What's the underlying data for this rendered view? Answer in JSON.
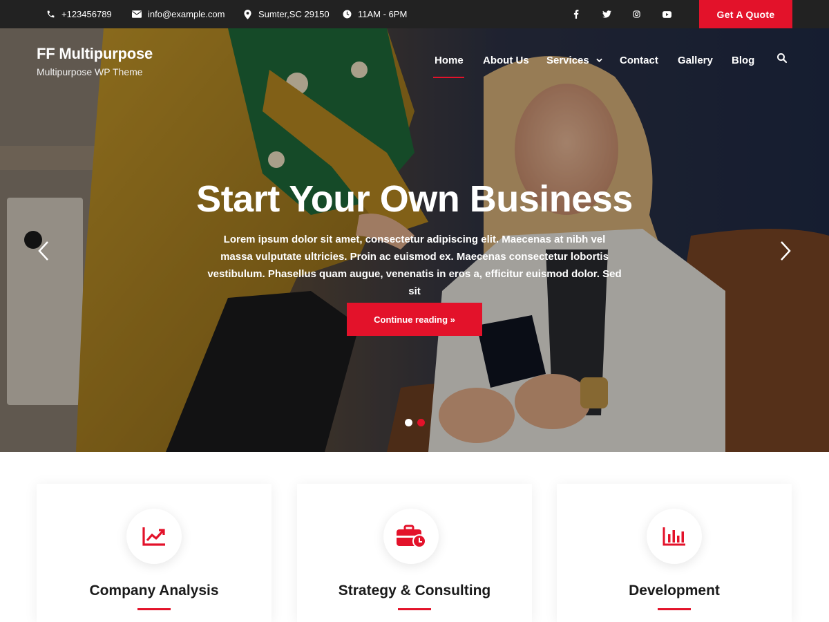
{
  "colors": {
    "accent": "#e3122a",
    "topbar_bg": "#222222",
    "text_dark": "#1a1a1a"
  },
  "topbar": {
    "phone": "+123456789",
    "email": "info@example.com",
    "address": "Sumter,SC 29150",
    "hours": "11AM - 6PM",
    "social_icons": [
      "facebook-icon",
      "twitter-icon",
      "instagram-icon",
      "youtube-icon"
    ],
    "quote_label": "Get A Quote"
  },
  "header": {
    "site_title": "FF Multipurpose",
    "tagline": "Multipurpose WP Theme",
    "nav": [
      {
        "label": "Home",
        "active": true
      },
      {
        "label": "About Us"
      },
      {
        "label": "Services",
        "has_dropdown": true
      },
      {
        "label": "Contact"
      },
      {
        "label": "Gallery"
      },
      {
        "label": "Blog"
      }
    ]
  },
  "hero": {
    "title": "Start Your Own Business",
    "text": "Lorem ipsum dolor sit amet, consectetur adipiscing elit. Maecenas at nibh vel massa vulputate ultricies. Proin ac euismod ex. Maecenas consectetur lobortis vestibulum. Phasellus quam augue, venenatis in eros a, efficitur euismod dolor. Sed sit",
    "cta_label": "Continue reading »",
    "slides": 2,
    "active_slide": 2
  },
  "services": [
    {
      "title": "Company Analysis",
      "icon": "chart-line-icon"
    },
    {
      "title": "Strategy & Consulting",
      "icon": "briefcase-clock-icon"
    },
    {
      "title": "Development",
      "icon": "bar-chart-icon"
    }
  ]
}
